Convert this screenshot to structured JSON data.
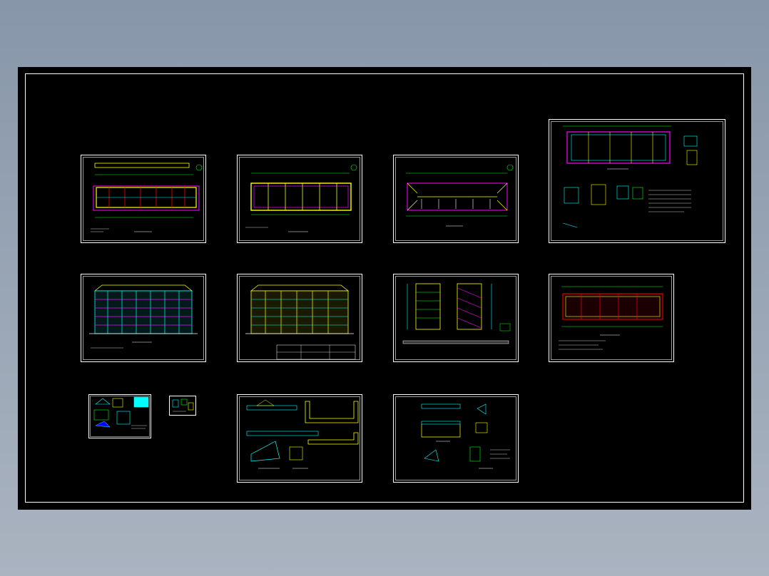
{
  "viewer": {
    "background_colors": [
      "#8796a9",
      "#aab3c0"
    ],
    "canvas_color": "#000000"
  },
  "drawing_colors": {
    "frame": "#ffffff",
    "axis": "#00ff00",
    "wall": "#ffff00",
    "accent": "#ff00ff",
    "detail": "#00ffff",
    "hatch": "#ff0000"
  },
  "sheets": [
    {
      "id": "floor-plan-1",
      "kind": "plan"
    },
    {
      "id": "floor-plan-2",
      "kind": "plan"
    },
    {
      "id": "roof-plan",
      "kind": "roof"
    },
    {
      "id": "foundation-details",
      "kind": "details"
    },
    {
      "id": "front-elevation",
      "kind": "elevation"
    },
    {
      "id": "rear-elevation",
      "kind": "elevation"
    },
    {
      "id": "section",
      "kind": "section"
    },
    {
      "id": "floor-plan-3",
      "kind": "plan"
    },
    {
      "id": "small-details-a",
      "kind": "small"
    },
    {
      "id": "small-details-b",
      "kind": "small"
    },
    {
      "id": "stair-details",
      "kind": "details"
    },
    {
      "id": "node-details",
      "kind": "details"
    }
  ]
}
